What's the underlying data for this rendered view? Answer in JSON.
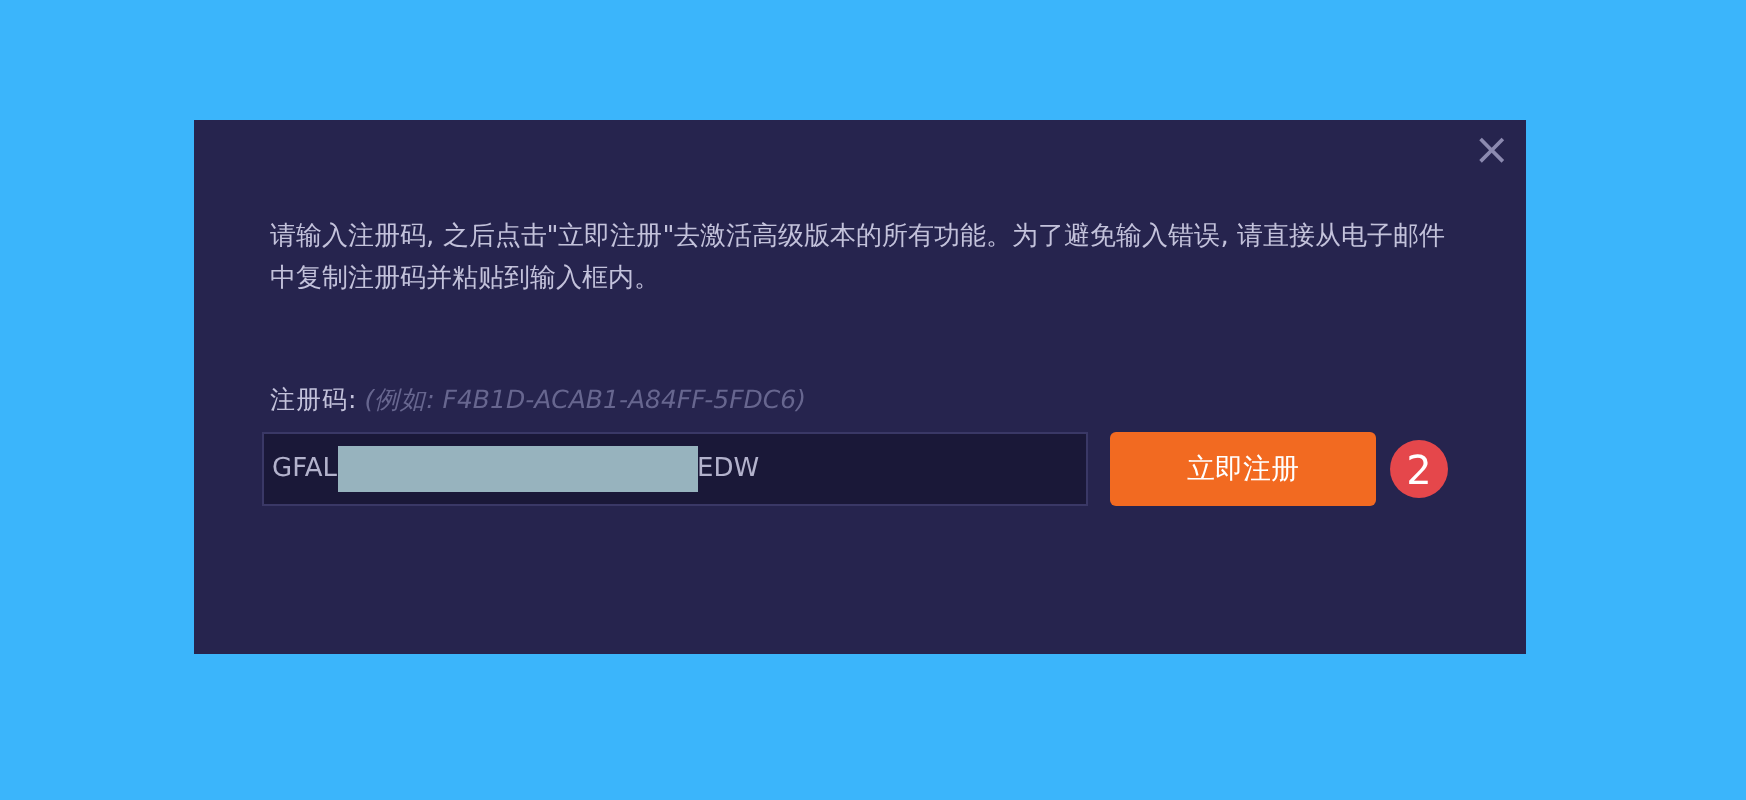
{
  "dialog": {
    "close": "×",
    "message": "请输入注册码, 之后点击\"立即注册\"去激活高级版本的所有功能。为了避免输入错误, 请直接从电子邮件中复制注册码并粘贴到输入框内。",
    "field": {
      "label": "注册码:",
      "example": "(例如: F4B1D-ACAB1-A84FF-5FDC6)",
      "value_start": "GFAL",
      "value_end": "EDW"
    },
    "button": "立即注册",
    "badge": "2"
  }
}
